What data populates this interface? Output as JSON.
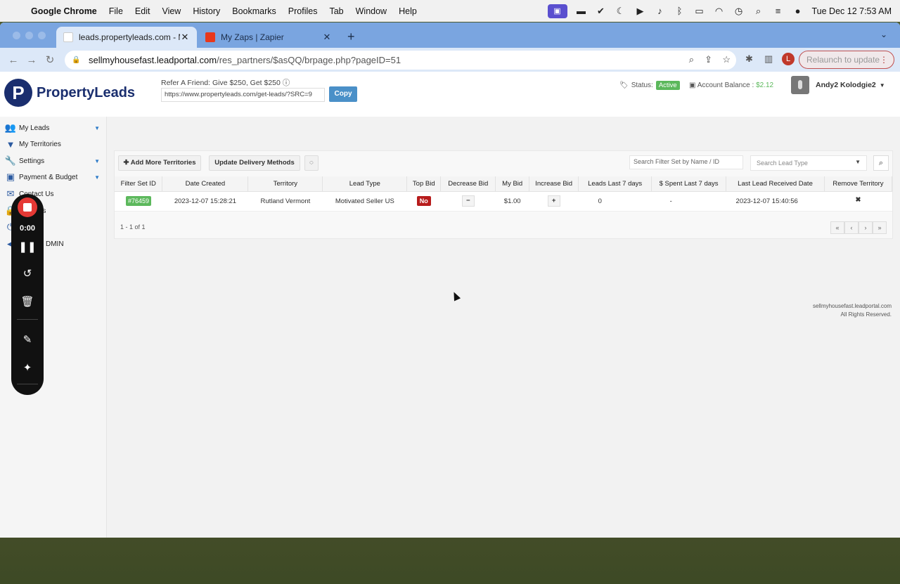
{
  "menubar": {
    "app": "Google Chrome",
    "items": [
      "File",
      "Edit",
      "View",
      "History",
      "Bookmarks",
      "Profiles",
      "Tab",
      "Window",
      "Help"
    ],
    "clock": "Tue Dec 12  7:53 AM"
  },
  "browser": {
    "tabs": [
      {
        "label": "leads.propertyleads.com - My",
        "active": true
      },
      {
        "label": "My Zaps | Zapier",
        "active": false
      }
    ],
    "url_domain": "sellmyhousefast.leadportal.com",
    "url_path": "/res_partners/$asQQ/brpage.php?pageID=51",
    "relaunch_label": "Relaunch to update",
    "profile_initial": "L"
  },
  "header": {
    "logo_text": "PropertyLeads",
    "refer_label": "Refer A Friend: Give $250, Get $250",
    "refer_url": "https://www.propertyleads.com/get-leads/?SRC=9",
    "copy_label": "Copy",
    "status_label": "Status:",
    "status_value": "Active",
    "balance_label": "Account Balance :",
    "balance_value": "$2.12",
    "user_name": "Andy2 Kolodgie2"
  },
  "sidebar": {
    "items": [
      {
        "label": "My Leads",
        "icon": "users-icon",
        "has_caret": true
      },
      {
        "label": "My Territories",
        "icon": "filter-icon",
        "has_caret": false
      },
      {
        "label": "Settings",
        "icon": "wrench-icon",
        "has_caret": true
      },
      {
        "label": "Payment & Budget",
        "icon": "money-icon",
        "has_caret": true
      },
      {
        "label": "Contact Us",
        "icon": "envelope-icon",
        "has_caret": false
      },
      {
        "label": "ings",
        "icon": "lock-icon",
        "has_caret": false
      },
      {
        "label": "",
        "icon": "power-icon",
        "has_caret": false
      },
      {
        "label": "DMIN",
        "icon": "back-icon",
        "has_caret": false
      }
    ]
  },
  "recorder": {
    "time": "0:00"
  },
  "panel": {
    "add_territories_label": "Add More Territories",
    "update_delivery_label": "Update Delivery Methods",
    "filter_placeholder": "Search Filter Set by Name / ID",
    "lead_type_placeholder": "Search Lead Type",
    "columns": [
      "Filter Set ID",
      "Date Created",
      "Territory",
      "Lead Type",
      "Top Bid",
      "Decrease Bid",
      "My Bid",
      "Increase Bid",
      "Leads Last 7 days",
      "$ Spent Last 7 days",
      "Last Lead Received Date",
      "Remove Territory"
    ],
    "rows": [
      {
        "id": "#76459",
        "date_created": "2023-12-07 15:28:21",
        "territory": "Rutland Vermont",
        "lead_type": "Motivated Seller US",
        "top_bid": "No",
        "my_bid": "$1.00",
        "leads_7d": "0",
        "spent_7d": "-",
        "last_received": "2023-12-07 15:40:56"
      }
    ],
    "pager_info": "1 - 1 of 1"
  },
  "footer": {
    "line1": "sellmyhousefast.leadportal.com",
    "line2": "All Rights Reserved."
  },
  "colors": {
    "brand": "#1a2e6e",
    "active_green": "#5cb85c",
    "no_red": "#b71c1c",
    "copy_blue": "#4a90c8",
    "tab_blue": "#7aa5e0"
  }
}
